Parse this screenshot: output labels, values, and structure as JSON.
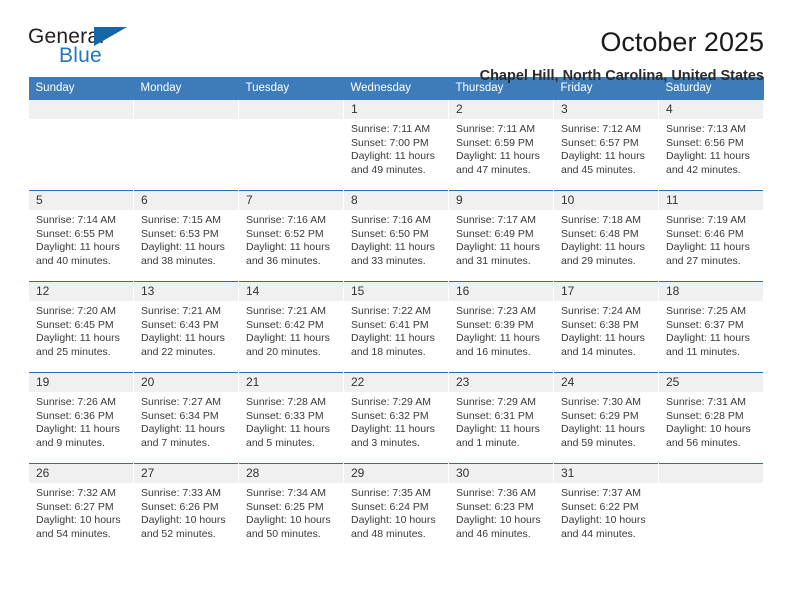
{
  "brand": {
    "name_top": "General",
    "name_bottom": "Blue",
    "triangle_color": "#1565a8",
    "blue_text_color": "#2077c0"
  },
  "header": {
    "title": "October 2025",
    "location": "Chapel Hill, North Carolina, United States",
    "header_bg": "#3d7cb8",
    "row_divider_color": "#2c6ca8",
    "daynum_bg": "#f0f0f0"
  },
  "weekday_headers": [
    "Sunday",
    "Monday",
    "Tuesday",
    "Wednesday",
    "Thursday",
    "Friday",
    "Saturday"
  ],
  "labels": {
    "sunrise_prefix": "Sunrise:",
    "sunset_prefix": "Sunset:",
    "daylight_prefix": "Daylight:"
  },
  "weeks": [
    [
      {
        "day": "",
        "sunrise": "",
        "sunset": "",
        "daylight_line1": "",
        "daylight_line2": ""
      },
      {
        "day": "",
        "sunrise": "",
        "sunset": "",
        "daylight_line1": "",
        "daylight_line2": ""
      },
      {
        "day": "",
        "sunrise": "",
        "sunset": "",
        "daylight_line1": "",
        "daylight_line2": ""
      },
      {
        "day": "1",
        "sunrise": "Sunrise: 7:11 AM",
        "sunset": "Sunset: 7:00 PM",
        "daylight_line1": "Daylight: 11 hours",
        "daylight_line2": "and 49 minutes."
      },
      {
        "day": "2",
        "sunrise": "Sunrise: 7:11 AM",
        "sunset": "Sunset: 6:59 PM",
        "daylight_line1": "Daylight: 11 hours",
        "daylight_line2": "and 47 minutes."
      },
      {
        "day": "3",
        "sunrise": "Sunrise: 7:12 AM",
        "sunset": "Sunset: 6:57 PM",
        "daylight_line1": "Daylight: 11 hours",
        "daylight_line2": "and 45 minutes."
      },
      {
        "day": "4",
        "sunrise": "Sunrise: 7:13 AM",
        "sunset": "Sunset: 6:56 PM",
        "daylight_line1": "Daylight: 11 hours",
        "daylight_line2": "and 42 minutes."
      }
    ],
    [
      {
        "day": "5",
        "sunrise": "Sunrise: 7:14 AM",
        "sunset": "Sunset: 6:55 PM",
        "daylight_line1": "Daylight: 11 hours",
        "daylight_line2": "and 40 minutes."
      },
      {
        "day": "6",
        "sunrise": "Sunrise: 7:15 AM",
        "sunset": "Sunset: 6:53 PM",
        "daylight_line1": "Daylight: 11 hours",
        "daylight_line2": "and 38 minutes."
      },
      {
        "day": "7",
        "sunrise": "Sunrise: 7:16 AM",
        "sunset": "Sunset: 6:52 PM",
        "daylight_line1": "Daylight: 11 hours",
        "daylight_line2": "and 36 minutes."
      },
      {
        "day": "8",
        "sunrise": "Sunrise: 7:16 AM",
        "sunset": "Sunset: 6:50 PM",
        "daylight_line1": "Daylight: 11 hours",
        "daylight_line2": "and 33 minutes."
      },
      {
        "day": "9",
        "sunrise": "Sunrise: 7:17 AM",
        "sunset": "Sunset: 6:49 PM",
        "daylight_line1": "Daylight: 11 hours",
        "daylight_line2": "and 31 minutes."
      },
      {
        "day": "10",
        "sunrise": "Sunrise: 7:18 AM",
        "sunset": "Sunset: 6:48 PM",
        "daylight_line1": "Daylight: 11 hours",
        "daylight_line2": "and 29 minutes."
      },
      {
        "day": "11",
        "sunrise": "Sunrise: 7:19 AM",
        "sunset": "Sunset: 6:46 PM",
        "daylight_line1": "Daylight: 11 hours",
        "daylight_line2": "and 27 minutes."
      }
    ],
    [
      {
        "day": "12",
        "sunrise": "Sunrise: 7:20 AM",
        "sunset": "Sunset: 6:45 PM",
        "daylight_line1": "Daylight: 11 hours",
        "daylight_line2": "and 25 minutes."
      },
      {
        "day": "13",
        "sunrise": "Sunrise: 7:21 AM",
        "sunset": "Sunset: 6:43 PM",
        "daylight_line1": "Daylight: 11 hours",
        "daylight_line2": "and 22 minutes."
      },
      {
        "day": "14",
        "sunrise": "Sunrise: 7:21 AM",
        "sunset": "Sunset: 6:42 PM",
        "daylight_line1": "Daylight: 11 hours",
        "daylight_line2": "and 20 minutes."
      },
      {
        "day": "15",
        "sunrise": "Sunrise: 7:22 AM",
        "sunset": "Sunset: 6:41 PM",
        "daylight_line1": "Daylight: 11 hours",
        "daylight_line2": "and 18 minutes."
      },
      {
        "day": "16",
        "sunrise": "Sunrise: 7:23 AM",
        "sunset": "Sunset: 6:39 PM",
        "daylight_line1": "Daylight: 11 hours",
        "daylight_line2": "and 16 minutes."
      },
      {
        "day": "17",
        "sunrise": "Sunrise: 7:24 AM",
        "sunset": "Sunset: 6:38 PM",
        "daylight_line1": "Daylight: 11 hours",
        "daylight_line2": "and 14 minutes."
      },
      {
        "day": "18",
        "sunrise": "Sunrise: 7:25 AM",
        "sunset": "Sunset: 6:37 PM",
        "daylight_line1": "Daylight: 11 hours",
        "daylight_line2": "and 11 minutes."
      }
    ],
    [
      {
        "day": "19",
        "sunrise": "Sunrise: 7:26 AM",
        "sunset": "Sunset: 6:36 PM",
        "daylight_line1": "Daylight: 11 hours",
        "daylight_line2": "and 9 minutes."
      },
      {
        "day": "20",
        "sunrise": "Sunrise: 7:27 AM",
        "sunset": "Sunset: 6:34 PM",
        "daylight_line1": "Daylight: 11 hours",
        "daylight_line2": "and 7 minutes."
      },
      {
        "day": "21",
        "sunrise": "Sunrise: 7:28 AM",
        "sunset": "Sunset: 6:33 PM",
        "daylight_line1": "Daylight: 11 hours",
        "daylight_line2": "and 5 minutes."
      },
      {
        "day": "22",
        "sunrise": "Sunrise: 7:29 AM",
        "sunset": "Sunset: 6:32 PM",
        "daylight_line1": "Daylight: 11 hours",
        "daylight_line2": "and 3 minutes."
      },
      {
        "day": "23",
        "sunrise": "Sunrise: 7:29 AM",
        "sunset": "Sunset: 6:31 PM",
        "daylight_line1": "Daylight: 11 hours",
        "daylight_line2": "and 1 minute."
      },
      {
        "day": "24",
        "sunrise": "Sunrise: 7:30 AM",
        "sunset": "Sunset: 6:29 PM",
        "daylight_line1": "Daylight: 11 hours",
        "daylight_line2": "and 59 minutes."
      },
      {
        "day": "25",
        "sunrise": "Sunrise: 7:31 AM",
        "sunset": "Sunset: 6:28 PM",
        "daylight_line1": "Daylight: 10 hours",
        "daylight_line2": "and 56 minutes."
      }
    ],
    [
      {
        "day": "26",
        "sunrise": "Sunrise: 7:32 AM",
        "sunset": "Sunset: 6:27 PM",
        "daylight_line1": "Daylight: 10 hours",
        "daylight_line2": "and 54 minutes."
      },
      {
        "day": "27",
        "sunrise": "Sunrise: 7:33 AM",
        "sunset": "Sunset: 6:26 PM",
        "daylight_line1": "Daylight: 10 hours",
        "daylight_line2": "and 52 minutes."
      },
      {
        "day": "28",
        "sunrise": "Sunrise: 7:34 AM",
        "sunset": "Sunset: 6:25 PM",
        "daylight_line1": "Daylight: 10 hours",
        "daylight_line2": "and 50 minutes."
      },
      {
        "day": "29",
        "sunrise": "Sunrise: 7:35 AM",
        "sunset": "Sunset: 6:24 PM",
        "daylight_line1": "Daylight: 10 hours",
        "daylight_line2": "and 48 minutes."
      },
      {
        "day": "30",
        "sunrise": "Sunrise: 7:36 AM",
        "sunset": "Sunset: 6:23 PM",
        "daylight_line1": "Daylight: 10 hours",
        "daylight_line2": "and 46 minutes."
      },
      {
        "day": "31",
        "sunrise": "Sunrise: 7:37 AM",
        "sunset": "Sunset: 6:22 PM",
        "daylight_line1": "Daylight: 10 hours",
        "daylight_line2": "and 44 minutes."
      },
      {
        "day": "",
        "sunrise": "",
        "sunset": "",
        "daylight_line1": "",
        "daylight_line2": ""
      }
    ]
  ]
}
